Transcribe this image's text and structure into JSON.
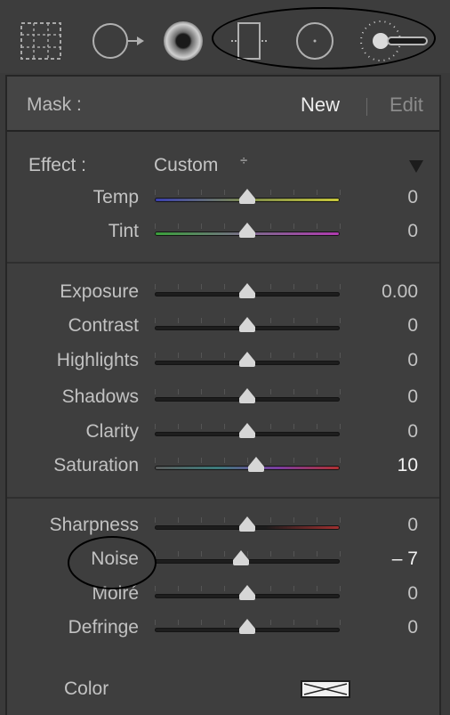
{
  "toolbar": {
    "tools": [
      {
        "name": "crop-overlay-icon"
      },
      {
        "name": "spot-removal-icon"
      },
      {
        "name": "red-eye-icon"
      },
      {
        "name": "graduated-filter-icon"
      },
      {
        "name": "radial-filter-icon"
      },
      {
        "name": "adjustment-brush-icon"
      }
    ]
  },
  "mask": {
    "label": "Mask :",
    "new_label": "New",
    "edit_label": "Edit"
  },
  "effect": {
    "label": "Effect :",
    "value": "Custom",
    "spinner": "÷"
  },
  "colors": {
    "temp_track": "linear-gradient(90deg,#3a3fb0,#7c8a4a,#c8c83a)",
    "tint_track": "linear-gradient(90deg,#3aa03a,#7a6a8a,#b03ab0)",
    "gray_track": "#1d1d1d",
    "saturation_track": "linear-gradient(90deg,#5a5a5a,#3c7a7a,#7a3ca0,#b03030)",
    "sharpness_track": "linear-gradient(90deg,#1d1d1d 60%,#a03030)"
  },
  "groups": [
    {
      "rows": [
        {
          "label": "Temp",
          "value": "0",
          "level": 0.5,
          "track": "temp_track"
        },
        {
          "label": "Tint",
          "value": "0",
          "level": 0.5,
          "track": "tint_track"
        }
      ]
    },
    {
      "rows": [
        {
          "label": "Exposure",
          "value": "0.00",
          "level": 0.5,
          "track": "gray_track"
        },
        {
          "label": "Contrast",
          "value": "0",
          "level": 0.5,
          "track": "gray_track"
        },
        {
          "label": "Highlights",
          "value": "0",
          "level": 0.5,
          "track": "gray_track"
        },
        {
          "label": "Shadows",
          "value": "0",
          "level": 0.5,
          "track": "gray_track"
        },
        {
          "label": "Clarity",
          "value": "0",
          "level": 0.5,
          "track": "gray_track"
        },
        {
          "label": "Saturation",
          "value": "10",
          "level": 0.55,
          "track": "saturation_track",
          "strong": true
        }
      ]
    },
    {
      "rows": [
        {
          "label": "Sharpness",
          "value": "0",
          "level": 0.5,
          "track": "sharpness_track"
        },
        {
          "label": "Noise",
          "value": "– 7",
          "level": 0.465,
          "track": "gray_track",
          "strong": true
        },
        {
          "label": "Moiré",
          "value": "0",
          "level": 0.5,
          "track": "gray_track"
        },
        {
          "label": "Defringe",
          "value": "0",
          "level": 0.5,
          "track": "gray_track"
        }
      ]
    }
  ],
  "color_row": {
    "label": "Color"
  }
}
